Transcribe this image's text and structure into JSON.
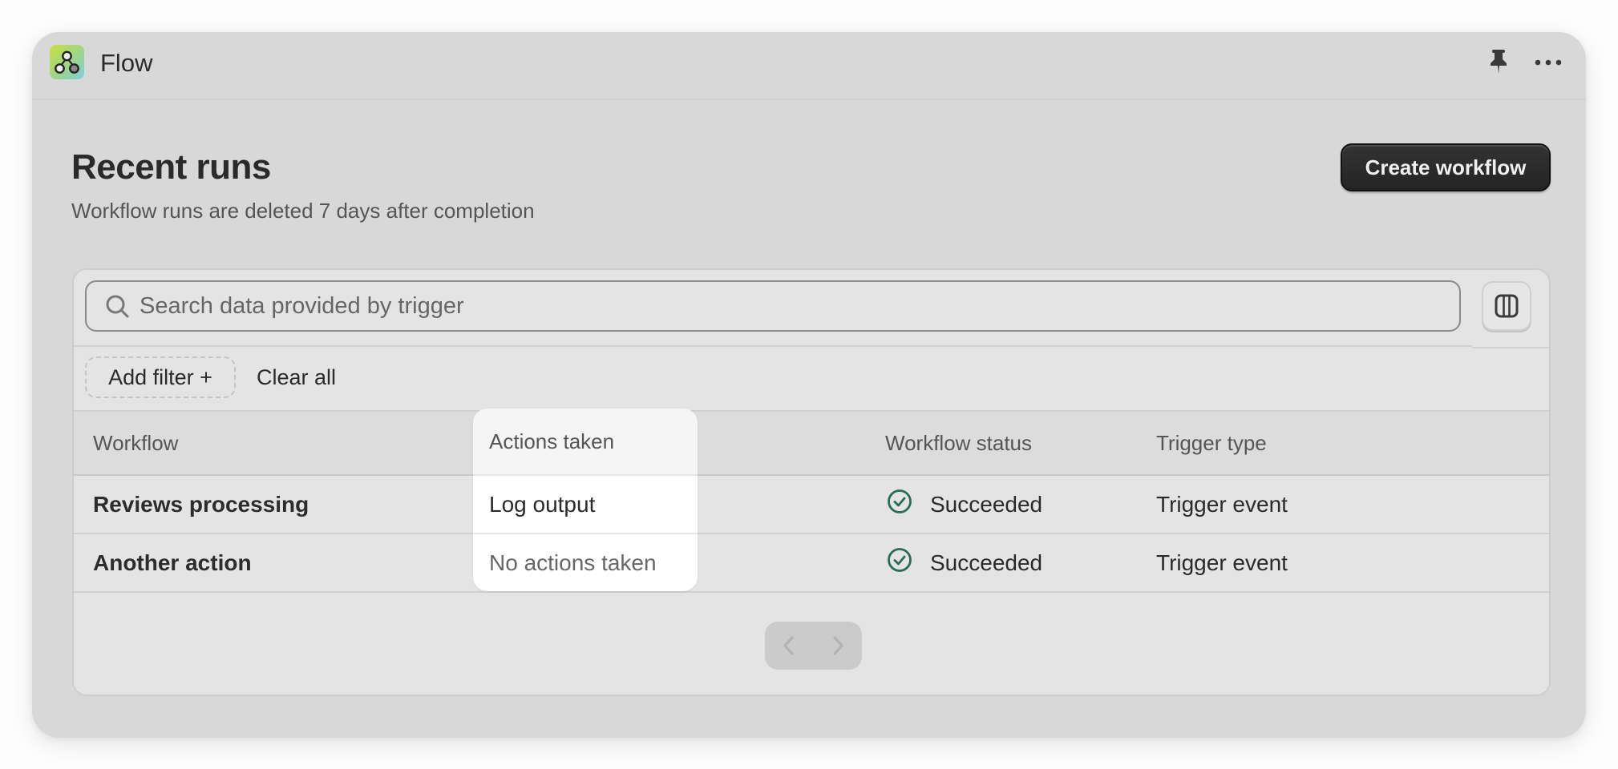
{
  "app": {
    "name": "Flow",
    "logo_icon": "flow-nodes-icon",
    "actions": [
      {
        "name": "pin",
        "icon": "pin-icon"
      },
      {
        "name": "more",
        "icon": "more-horizontal-icon"
      }
    ]
  },
  "page": {
    "title": "Recent runs",
    "subtitle": "Workflow runs are deleted 7 days after completion",
    "create_button": "Create workflow"
  },
  "search": {
    "placeholder": "Search data provided by trigger",
    "value": "",
    "icon": "search-icon",
    "columns_button_icon": "columns-icon"
  },
  "filters": {
    "add_filter_label": "Add filter +",
    "clear_all_label": "Clear all"
  },
  "table": {
    "columns": [
      "Workflow",
      "Actions taken",
      "Workflow status",
      "Trigger type"
    ],
    "highlighted_column": "Actions taken",
    "rows": [
      {
        "workflow": "Reviews processing",
        "actions": "Log output",
        "status": "Succeeded",
        "trigger": "Trigger event"
      },
      {
        "workflow": "Another action",
        "actions": "No actions taken",
        "status": "Succeeded",
        "trigger": "Trigger event"
      }
    ]
  },
  "pagination": {
    "prev_icon": "chevron-left-icon",
    "next_icon": "chevron-right-icon",
    "prev_enabled": false,
    "next_enabled": false
  },
  "colors": {
    "success": "#2a6b55",
    "primary_button": "#2b2b2b",
    "window_bg": "#d8d8d8",
    "card_bg": "#e4e4e4"
  }
}
